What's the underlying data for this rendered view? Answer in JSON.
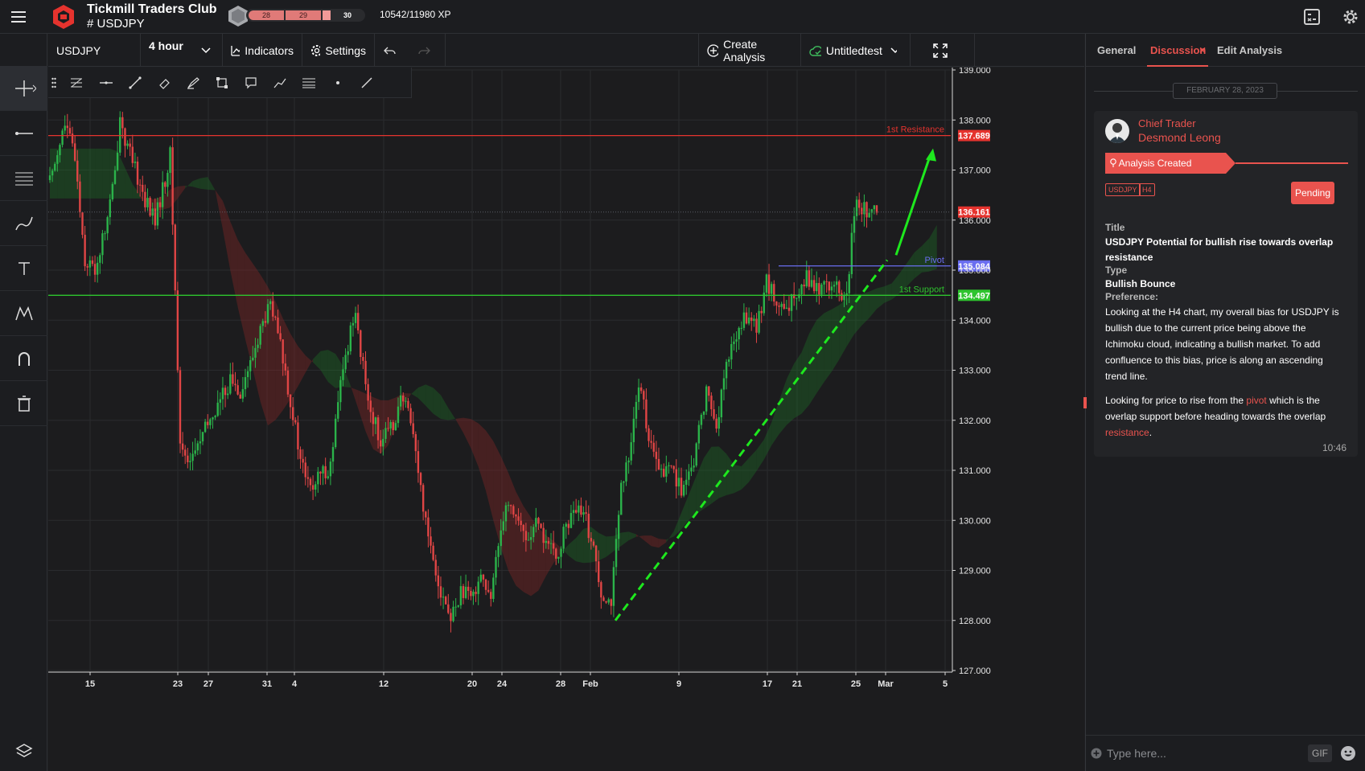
{
  "header": {
    "club": "Tickmill Traders Club",
    "symbol": "# USDJPY",
    "xp_segments": [
      "28",
      "29",
      "30"
    ],
    "xp_progress": 0.88,
    "xp_text": "10542/11980 XP",
    "icons": [
      "menu-icon",
      "tickmill-logo-icon",
      "rank-badge-icon",
      "calculator-icon",
      "gear-icon"
    ]
  },
  "toolbar": {
    "symbol": "USDJPY",
    "interval": "4 hour",
    "indicators": "Indicators",
    "settings": "Settings",
    "create_analysis": "Create Analysis",
    "layout_name": "Untitledtest"
  },
  "chart_data": {
    "type": "candlestick",
    "symbol": "USDJPY",
    "timeframe": "H4",
    "ylim": [
      127.0,
      139.0
    ],
    "y_ticks": [
      "139.000",
      "138.000",
      "137.000",
      "136.000",
      "135.000",
      "134.000",
      "133.000",
      "132.000",
      "131.000",
      "130.000",
      "129.000",
      "128.000",
      "127.000"
    ],
    "x_ticks": [
      "15",
      "23",
      "27",
      "31",
      "4",
      "12",
      "20",
      "24",
      "28",
      "Feb",
      "9",
      "17",
      "21",
      "25",
      "Mar",
      "5"
    ],
    "current_price": "136.161",
    "levels": [
      {
        "name": "1st Resistance",
        "price": "137.689",
        "color": "#e5332e"
      },
      {
        "name": "Pivot",
        "price": "135.084",
        "color": "#6a6ef0"
      },
      {
        "name": "1st Support",
        "price": "134.497",
        "color": "#2ec42e"
      }
    ],
    "indicator": "Ichimoku Cloud",
    "trendline": {
      "from": {
        "x": "Feb",
        "price": 128.0
      },
      "to": {
        "x": "Mar",
        "price": 135.2
      },
      "style": "dashed",
      "color": "#1ee81e"
    },
    "projection": {
      "from": {
        "x": "Mar",
        "price": 135.3
      },
      "to": {
        "x": "Mar",
        "price": 137.4
      },
      "color": "#1ee81e"
    },
    "price_path": [
      [
        0,
        136.8
      ],
      [
        3,
        137.4
      ],
      [
        6,
        137.9
      ],
      [
        10,
        137.3
      ],
      [
        14,
        135.2
      ],
      [
        18,
        135.0
      ],
      [
        22,
        135.8
      ],
      [
        26,
        136.9
      ],
      [
        28,
        138.1
      ],
      [
        30,
        137.6
      ],
      [
        34,
        137.0
      ],
      [
        38,
        136.4
      ],
      [
        42,
        136.0
      ],
      [
        46,
        136.8
      ],
      [
        48,
        137.3
      ],
      [
        50,
        134.6
      ],
      [
        52,
        131.5
      ],
      [
        56,
        131.2
      ],
      [
        60,
        131.6
      ],
      [
        64,
        132.0
      ],
      [
        68,
        132.4
      ],
      [
        72,
        132.8
      ],
      [
        76,
        132.6
      ],
      [
        80,
        133.1
      ],
      [
        84,
        133.8
      ],
      [
        88,
        134.3
      ],
      [
        92,
        133.5
      ],
      [
        96,
        132.4
      ],
      [
        100,
        131.2
      ],
      [
        104,
        130.6
      ],
      [
        108,
        130.9
      ],
      [
        112,
        131.1
      ],
      [
        116,
        132.7
      ],
      [
        120,
        133.8
      ],
      [
        122,
        134.3
      ],
      [
        124,
        133.3
      ],
      [
        128,
        132.2
      ],
      [
        132,
        131.6
      ],
      [
        136,
        131.8
      ],
      [
        140,
        132.4
      ],
      [
        144,
        132.1
      ],
      [
        148,
        130.6
      ],
      [
        152,
        129.5
      ],
      [
        156,
        128.6
      ],
      [
        160,
        128.0
      ],
      [
        164,
        128.6
      ],
      [
        168,
        128.4
      ],
      [
        172,
        129.0
      ],
      [
        176,
        128.3
      ],
      [
        178,
        129.3
      ],
      [
        182,
        130.4
      ],
      [
        186,
        130.1
      ],
      [
        190,
        129.6
      ],
      [
        194,
        129.9
      ],
      [
        198,
        129.6
      ],
      [
        202,
        129.2
      ],
      [
        206,
        129.9
      ],
      [
        210,
        130.2
      ],
      [
        214,
        130.0
      ],
      [
        218,
        129.2
      ],
      [
        220,
        128.6
      ],
      [
        224,
        128.4
      ],
      [
        228,
        130.6
      ],
      [
        230,
        131.0
      ],
      [
        234,
        132.4
      ],
      [
        236,
        132.6
      ],
      [
        240,
        131.4
      ],
      [
        244,
        130.9
      ],
      [
        248,
        131.1
      ],
      [
        252,
        130.6
      ],
      [
        256,
        130.9
      ],
      [
        258,
        131.5
      ],
      [
        262,
        132.6
      ],
      [
        266,
        131.9
      ],
      [
        270,
        133.1
      ],
      [
        274,
        133.7
      ],
      [
        278,
        134.1
      ],
      [
        282,
        133.8
      ],
      [
        286,
        134.8
      ],
      [
        290,
        134.3
      ],
      [
        294,
        134.1
      ],
      [
        298,
        134.6
      ],
      [
        302,
        134.9
      ],
      [
        306,
        134.6
      ],
      [
        310,
        134.8
      ],
      [
        314,
        134.6
      ],
      [
        318,
        134.4
      ],
      [
        320,
        135.6
      ],
      [
        322,
        136.3
      ],
      [
        326,
        136.2
      ],
      [
        330,
        136.1
      ]
    ]
  },
  "panel": {
    "tabs": [
      "General",
      "Discussion",
      "Edit Analysis"
    ],
    "close_glyph": "×",
    "date": "FEBRUARY 28, 2023",
    "role": "Chief Trader",
    "author": "Desmond Leong",
    "created_label": "Analysis Created",
    "tags": [
      "USDJPY",
      "H4"
    ],
    "status": "Pending",
    "title_label": "Title",
    "title": "USDJPY Potential for bullish rise towards overlap resistance",
    "type_label": "Type",
    "type": "Bullish Bounce",
    "pref_label": "Preference:",
    "pref_text": "Looking at the H4 chart, my overall bias for USDJPY is bullish due to the current price being above the Ichimoku cloud, indicating a bullish market. To add confluence to this bias, price is along an ascending trend line.",
    "pref2_a": "Looking for price to rise from the ",
    "pref2_pivot": "pivot",
    "pref2_b": " which is the overlap support before heading towards the overlap ",
    "pref2_res": "resistance",
    "pref2_c": ".",
    "time": "10:46",
    "input_placeholder": "Type here...",
    "gif": "GIF"
  }
}
